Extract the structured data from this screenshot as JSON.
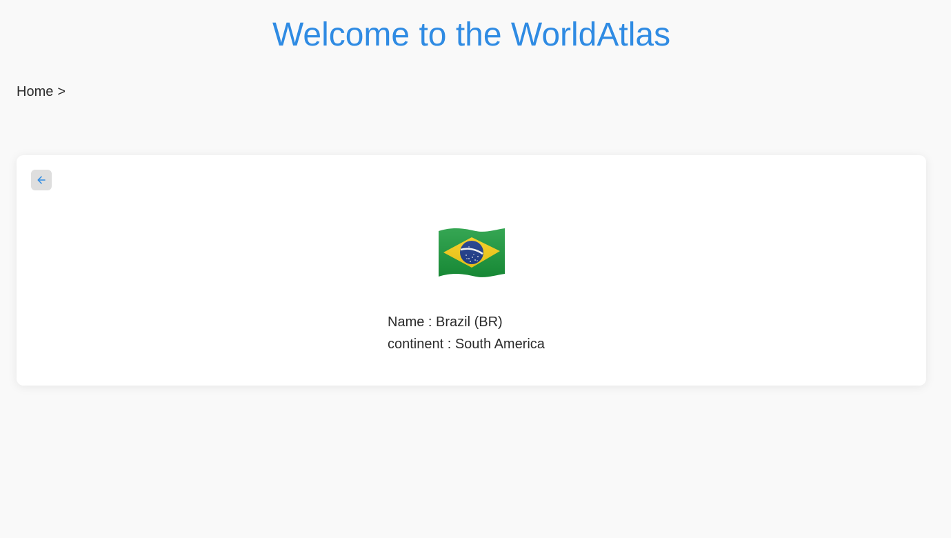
{
  "header": {
    "title": "Welcome to the WorldAtlas"
  },
  "breadcrumb": {
    "home_label": "Home",
    "separator": ">"
  },
  "country_card": {
    "back_icon": "arrow-left-icon",
    "flag_icon": "brazil-flag-icon",
    "name_label": "Name",
    "label_separator": " : ",
    "name_value": "Brazil (BR)",
    "continent_label": "continent",
    "continent_value": "South America"
  },
  "colors": {
    "accent": "#2f8be3",
    "page_background": "#f9f9f9",
    "card_background": "#ffffff",
    "back_button_background": "#dedede",
    "flag_green": "#1a9a3c",
    "flag_yellow": "#fcd116",
    "flag_blue": "#1a3a8c"
  }
}
